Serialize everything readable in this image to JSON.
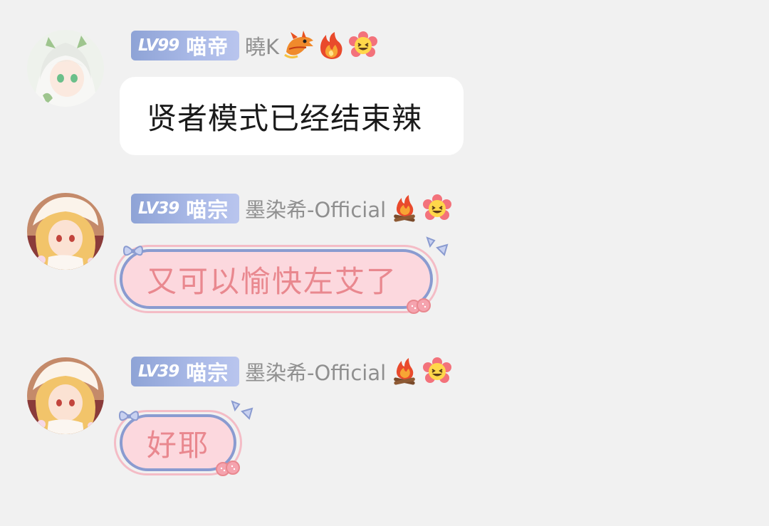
{
  "messages": [
    {
      "level": "LV99",
      "title": "喵帝",
      "username": "曉K",
      "icons": [
        "dragon-icon",
        "fire-icon",
        "grinning-flower-icon"
      ],
      "text": "贤者模式已经结束辣",
      "bubble_style": "white"
    },
    {
      "level": "LV39",
      "title": "喵宗",
      "username": "墨染希-Official",
      "icons": [
        "campfire-icon",
        "grinning-flower-icon"
      ],
      "text": "又可以愉快左艾了",
      "bubble_style": "pink-decorated"
    },
    {
      "level": "LV39",
      "title": "喵宗",
      "username": "墨染希-Official",
      "icons": [
        "campfire-icon",
        "grinning-flower-icon"
      ],
      "text": "好耶",
      "bubble_style": "pink-decorated"
    }
  ],
  "colors": {
    "background": "#f1f1f1",
    "badge": "#97a9dc",
    "username": "#8f8f8f",
    "pink_text": "#e9888f",
    "pink_fill": "#fcd8de",
    "pink_border": "#8a9bd0"
  }
}
